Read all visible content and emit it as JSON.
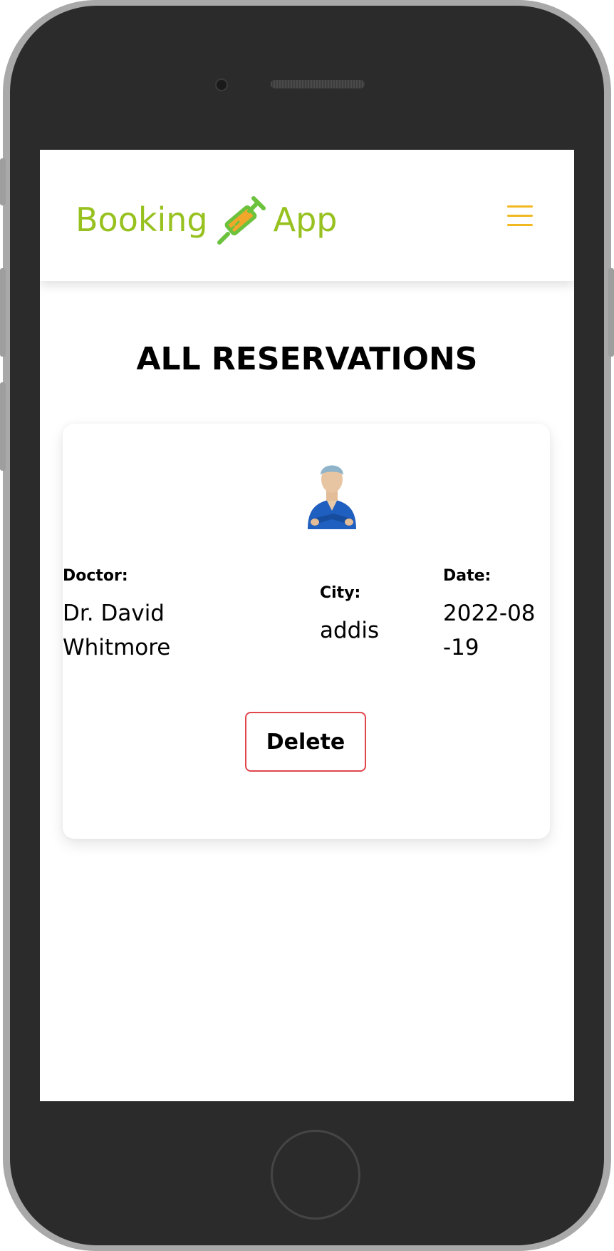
{
  "brand": {
    "name_left": "Booking",
    "name_right": "App",
    "logo_icon": "syringe-icon",
    "color": "#97c11f"
  },
  "nav": {
    "menu_icon": "hamburger-menu-icon",
    "menu_color": "#f2b81f"
  },
  "page": {
    "title": "ALL RESERVATIONS"
  },
  "reservations": [
    {
      "doctor_label": "Doctor:",
      "doctor_value": "Dr. David Whitmore",
      "city_label": "City:",
      "city_value": "addis",
      "date_label": "Date:",
      "date_value": "2022-08-19",
      "delete_label": "Delete"
    }
  ],
  "colors": {
    "delete_border": "#e0464c",
    "title": "#000000"
  }
}
